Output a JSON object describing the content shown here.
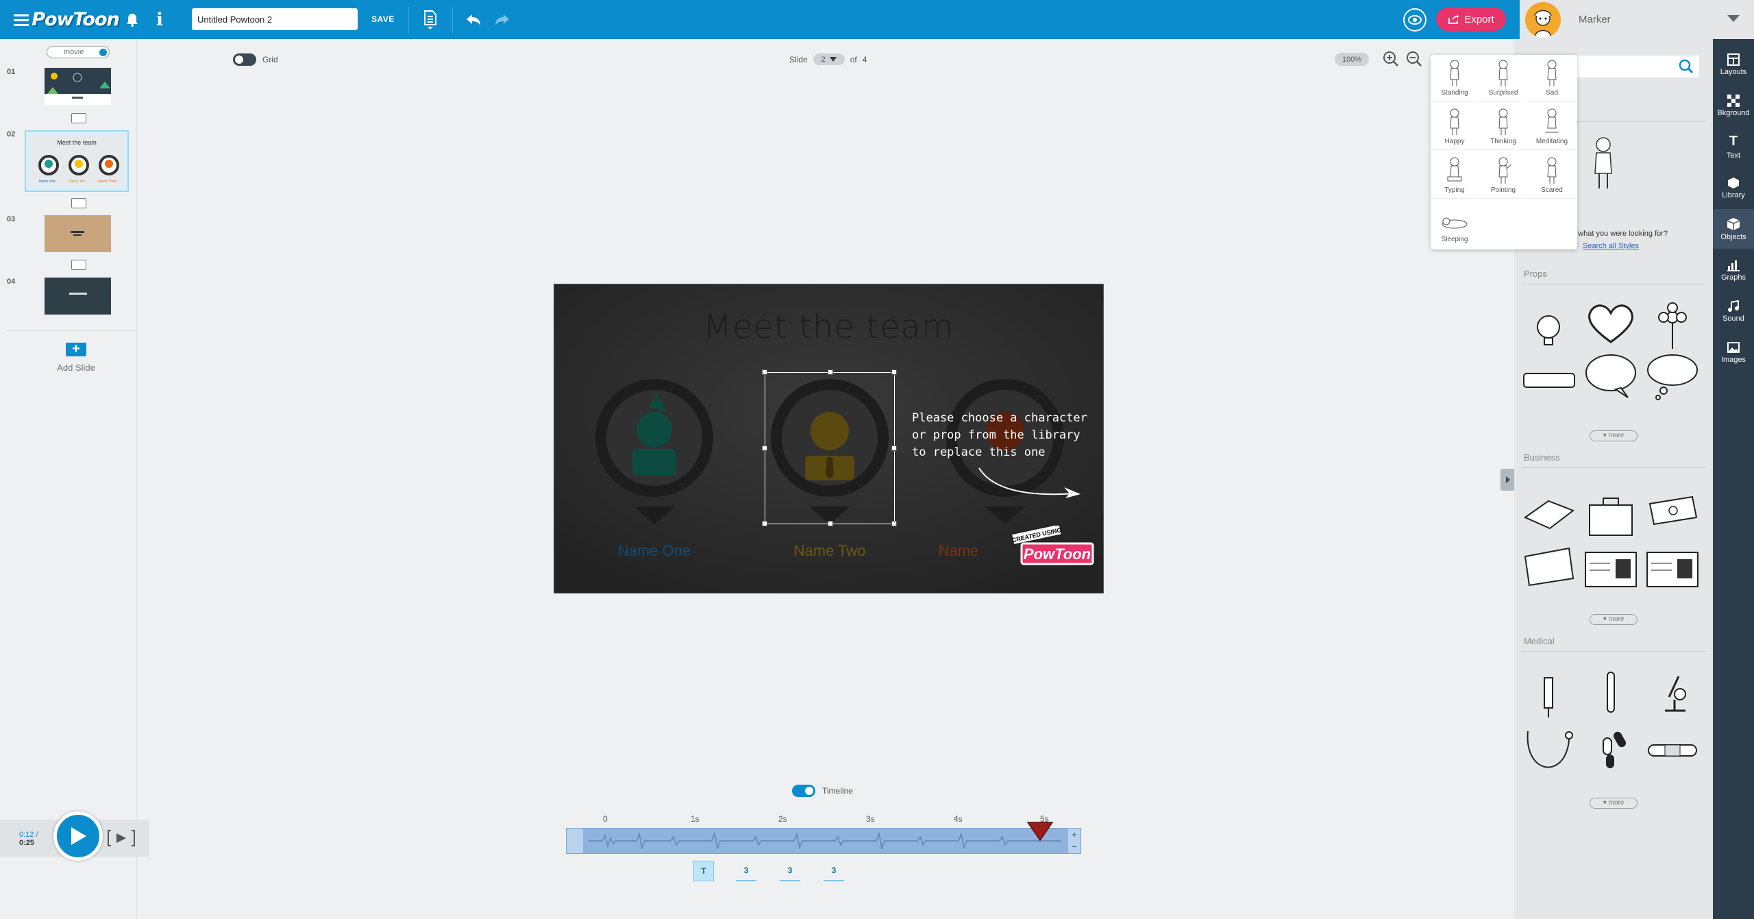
{
  "app": {
    "logo_text": "PowToon",
    "title_value": "Untitled Powtoon 2",
    "save_label": "SAVE",
    "export_label": "Export"
  },
  "user": {
    "name": "Marker"
  },
  "slides_panel": {
    "movie_label": "movie",
    "slides": [
      {
        "number": "01"
      },
      {
        "number": "02",
        "mini_title": "Meet the team",
        "mini_names": [
          "Name One",
          "Name Two",
          "Name Three"
        ]
      },
      {
        "number": "03"
      },
      {
        "number": "04"
      }
    ],
    "add_slide_label": "Add Slide"
  },
  "canvas": {
    "grid_label": "Grid",
    "slide_label": "Slide",
    "slide_current": "2",
    "of_label": "of",
    "slide_total": "4",
    "zoom": "100%",
    "title": "Meet the team",
    "names": [
      "Name One",
      "Name Two",
      "Name"
    ],
    "name_colors": [
      "#0f4d7a",
      "#6b5a10",
      "#7a3212"
    ],
    "hint": "Please choose a character or prop from the library to replace this one"
  },
  "playback": {
    "current": "0:12 /",
    "total": "0:25",
    "timeline_label": "Timeline",
    "ticks": [
      "0",
      "1s",
      "2s",
      "3s",
      "4s",
      "5s"
    ],
    "chips": [
      "T",
      "3",
      "3",
      "3"
    ]
  },
  "poses": [
    "Standing",
    "Surprised",
    "Sad",
    "Happy",
    "Thinking",
    "Meditating",
    "Typing",
    "Pointing",
    "Scared",
    "Sleeping"
  ],
  "library": {
    "notfound": "d what you were looking for?",
    "search_all": "Search all Styles",
    "sections": [
      {
        "title": "Props",
        "more": "more"
      },
      {
        "title": "Business",
        "more": "more"
      },
      {
        "title": "Medical",
        "more": "more"
      }
    ]
  },
  "toolbar": [
    "Layouts",
    "Bkground",
    "Text",
    "Library",
    "Objects",
    "Graphs",
    "Sound",
    "Images"
  ],
  "colors": {
    "brand": "#0a8ccd",
    "export": "#e8336b",
    "toolbar": "#2c3c4a"
  }
}
